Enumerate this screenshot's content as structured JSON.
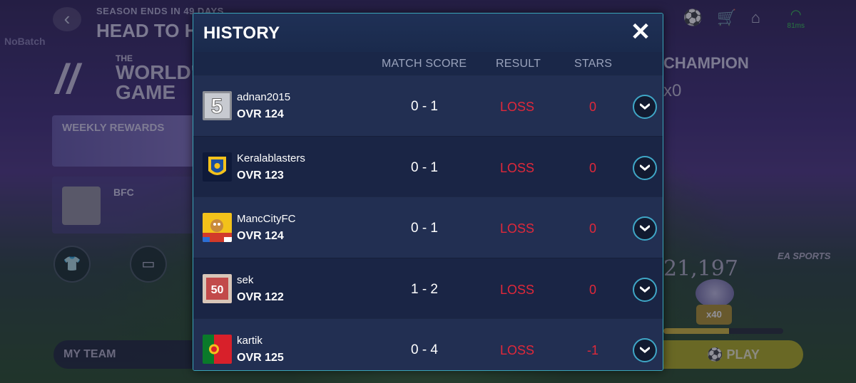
{
  "background": {
    "season_text": "SEASON ENDS IN 49 DAYS",
    "mode_title": "HEAD TO HEAD",
    "nobatch": "NoBatch",
    "logo_line1": "THE",
    "logo_line2": "WORLD'S",
    "logo_line3": "GAME",
    "weekly_rewards": "WEEKLY REWARDS",
    "club_name": "BFC",
    "champion_label": "CHAMPION",
    "multiplier": "x0",
    "points": "21,197",
    "reward_count": "x40",
    "progress_fraction": 0.55,
    "my_team": "MY TEAM",
    "play": "PLAY",
    "ping": "81ms",
    "brand": "EA SPORTS"
  },
  "modal": {
    "title": "HISTORY",
    "columns": {
      "match_score": "MATCH SCORE",
      "result": "RESULT",
      "stars": "STARS"
    },
    "rows": [
      {
        "username": "adnan2015",
        "ovr": "OVR 124",
        "score": "0 - 1",
        "result": "LOSS",
        "stars": "0",
        "badge": "number-five-badge"
      },
      {
        "username": "Keralablasters",
        "ovr": "OVR 123",
        "score": "0 - 1",
        "result": "LOSS",
        "stars": "0",
        "badge": "kerala-blasters-crest"
      },
      {
        "username": "MancCityFC",
        "ovr": "OVR 124",
        "score": "0 - 1",
        "result": "LOSS",
        "stars": "0",
        "badge": "cartoon-mascot-badge"
      },
      {
        "username": "sek",
        "ovr": "OVR 122",
        "score": "1 - 2",
        "result": "LOSS",
        "stars": "0",
        "badge": "number-fifty-badge"
      },
      {
        "username": "kartik",
        "ovr": "OVR 125",
        "score": "0 - 4",
        "result": "LOSS",
        "stars": "-1",
        "badge": "portugal-flag"
      }
    ]
  },
  "colors": {
    "loss_red": "#e0283a",
    "accent_teal": "#3aa5b8",
    "modal_bg": "#1b2745"
  }
}
